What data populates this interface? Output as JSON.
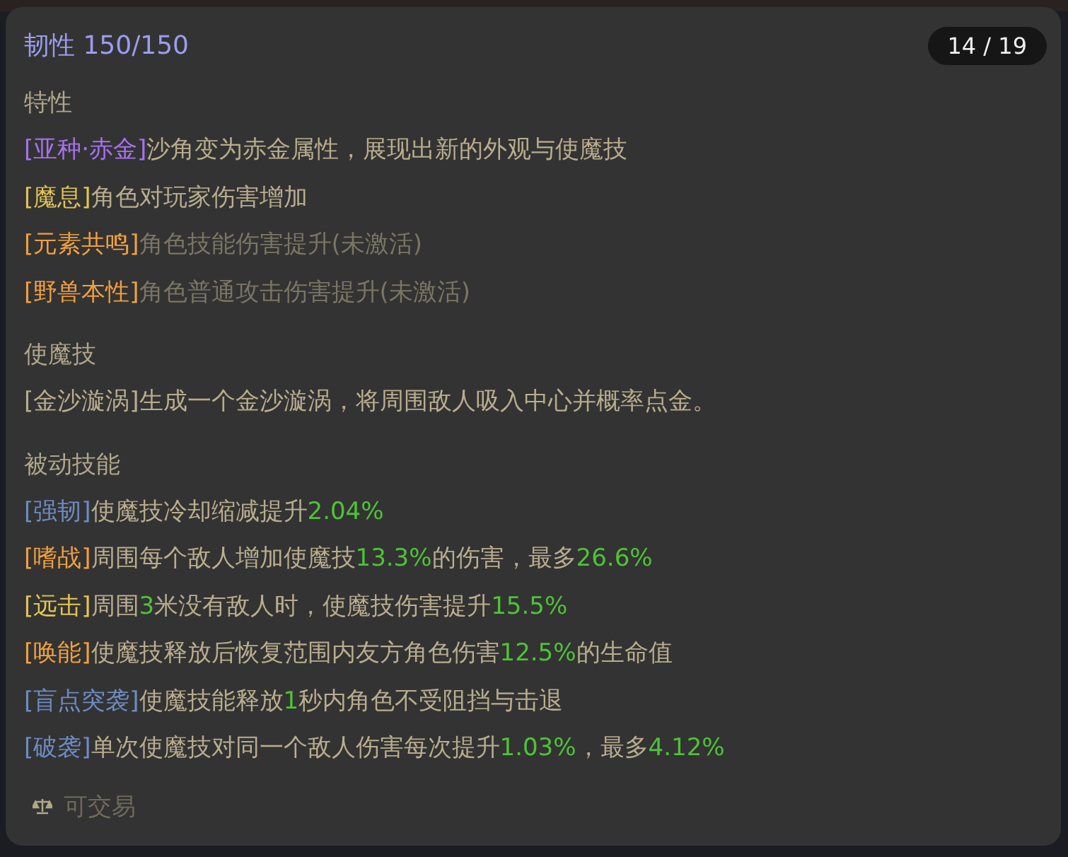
{
  "stat": {
    "label": "韧性",
    "value": "150/150"
  },
  "pager": "14 / 19",
  "sections": [
    {
      "title": "特性",
      "lines": [
        [
          {
            "text": "[亚种·赤金]",
            "color": "#a872f0"
          },
          {
            "text": "沙角变为赤金属性，展现出新的外观与使魔技",
            "color": "#b9ad8e"
          }
        ],
        [
          {
            "text": "[魔息]",
            "color": "#e2c456"
          },
          {
            "text": "角色对玩家伤害增加",
            "color": "#b9ad8e"
          }
        ],
        [
          {
            "text": "[元素共鸣]",
            "color": "#f0a040"
          },
          {
            "text": "角色技能伤害提升(未激活)",
            "color": "#7b7565"
          }
        ],
        [
          {
            "text": "[野兽本性]",
            "color": "#f0a040"
          },
          {
            "text": "角色普通攻击伤害提升(未激活)",
            "color": "#7b7565"
          }
        ]
      ]
    },
    {
      "title": "使魔技",
      "lines": [
        [
          {
            "text": "[金沙漩涡]生成一个金沙漩涡，将周围敌人吸入中心并概率点金。",
            "color": "#b9ad8e"
          }
        ]
      ]
    },
    {
      "title": "被动技能",
      "lines": [
        [
          {
            "text": "[强韧]",
            "color": "#6d8cc4"
          },
          {
            "text": "使魔技冷却缩减提升",
            "color": "#b9ad8e"
          },
          {
            "text": "2.04%",
            "color": "#4ec238"
          }
        ],
        [
          {
            "text": "[嗜战]",
            "color": "#f0a040"
          },
          {
            "text": "周围每个敌人增加使魔技",
            "color": "#b9ad8e"
          },
          {
            "text": "13.3%",
            "color": "#4ec238"
          },
          {
            "text": "的伤害，最多",
            "color": "#b9ad8e"
          },
          {
            "text": "26.6%",
            "color": "#4ec238"
          }
        ],
        [
          {
            "text": "[远击]",
            "color": "#e2c456"
          },
          {
            "text": "周围",
            "color": "#b9ad8e"
          },
          {
            "text": "3",
            "color": "#4ec238"
          },
          {
            "text": "米没有敌人时，使魔技伤害提升",
            "color": "#b9ad8e"
          },
          {
            "text": "15.5%",
            "color": "#4ec238"
          }
        ],
        [
          {
            "text": "[唤能]",
            "color": "#f0a040"
          },
          {
            "text": "使魔技释放后恢复范围内友方角色伤害",
            "color": "#b9ad8e"
          },
          {
            "text": "12.5%",
            "color": "#4ec238"
          },
          {
            "text": "的生命值",
            "color": "#b9ad8e"
          }
        ],
        [
          {
            "text": "[盲点突袭]",
            "color": "#6d8cc4"
          },
          {
            "text": "使魔技能释放",
            "color": "#b9ad8e"
          },
          {
            "text": "1",
            "color": "#4ec238"
          },
          {
            "text": "秒内角色不受阻挡与击退",
            "color": "#b9ad8e"
          }
        ],
        [
          {
            "text": "[破袭]",
            "color": "#6d8cc4"
          },
          {
            "text": "单次使魔技对同一个敌人伤害每次提升",
            "color": "#b9ad8e"
          },
          {
            "text": "1.03%",
            "color": "#4ec238"
          },
          {
            "text": "，最多",
            "color": "#b9ad8e"
          },
          {
            "text": "4.12%",
            "color": "#4ec238"
          }
        ]
      ]
    }
  ],
  "footer": {
    "label": "可交易"
  }
}
